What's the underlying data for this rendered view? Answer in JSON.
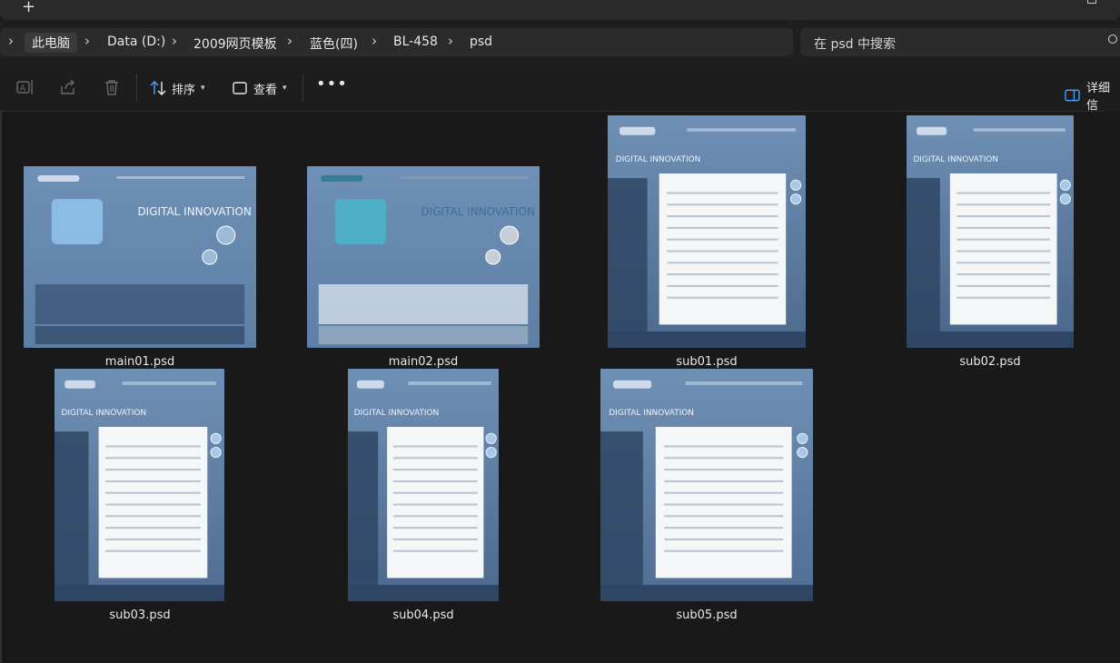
{
  "window": {
    "new_tab_label": "+"
  },
  "address_bar": {
    "segments": [
      "此电脑",
      "Data (D:)",
      "2009网页模板",
      "蓝色(四)",
      "BL-458",
      "psd"
    ]
  },
  "search": {
    "placeholder": "在 psd 中搜索"
  },
  "toolbar": {
    "sort_label": "排序",
    "view_label": "查看",
    "more_label": "•••",
    "details_label": "详细信"
  },
  "files": [
    {
      "name": "main01.psd",
      "variant": "main",
      "bg": "#5d7fa5"
    },
    {
      "name": "main02.psd",
      "variant": "main-light",
      "bg": "#dfe7ee"
    },
    {
      "name": "sub01.psd",
      "variant": "sub",
      "bg": "#4d6a8e"
    },
    {
      "name": "sub02.psd",
      "variant": "sub",
      "bg": "#4a6589"
    },
    {
      "name": "sub03.psd",
      "variant": "sub",
      "bg": "#4f6c90"
    },
    {
      "name": "sub04.psd",
      "variant": "sub",
      "bg": "#4b688c"
    },
    {
      "name": "sub05.psd",
      "variant": "sub",
      "bg": "#506d92"
    }
  ]
}
